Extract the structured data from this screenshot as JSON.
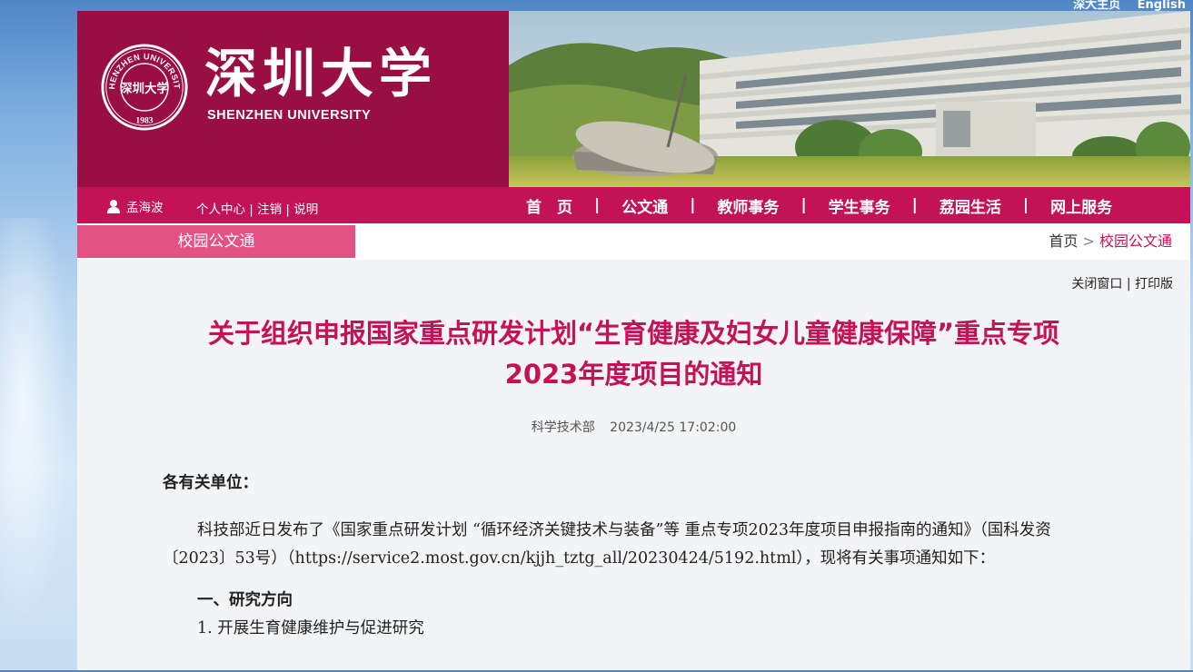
{
  "top_links": {
    "home": "深大主页",
    "english": "English"
  },
  "brand": {
    "cn_name": "深圳大学",
    "en_name": "SHENZHEN UNIVERSITY",
    "seal_text_top": "SHENZHEN UNIVERSITY",
    "seal_year": "1983",
    "seal_center": "深圳大学"
  },
  "user": {
    "name": "孟海波",
    "links": [
      "个人中心",
      "注销",
      "说明"
    ]
  },
  "nav": {
    "items": [
      "首　页",
      "公文通",
      "教师事务",
      "学生事务",
      "荔园生活",
      "网上服务"
    ]
  },
  "subnav": {
    "section": "校园公文通",
    "breadcrumb_home": "首页",
    "breadcrumb_sep": ">",
    "breadcrumb_current": "校园公文通"
  },
  "tools": {
    "close": "关闭窗口",
    "sep": "|",
    "print": "打印版"
  },
  "article": {
    "title_line1": "关于组织申报国家重点研发计划“生育健康及妇女儿童健康保障”重点专项",
    "title_line2": "2023年度项目的通知",
    "department": "科学技术部",
    "datetime": "2023/4/25 17:02:00",
    "salutation": "各有关单位：",
    "paragraph1": "科技部近日发布了《国家重点研发计划 “循环经济关键技术与装备”等 重点专项2023年度项目申报指南的通知》（国科发资〔2023〕53号）（https://service2.most.gov.cn/kjjh_tztg_all/20230424/5192.html），现将有关事项通知如下：",
    "section1": "一、研究方向",
    "item1": "1.  开展生育健康维护与促进研究"
  },
  "colors": {
    "brand_dark": "#9a0f43",
    "nav_bg": "#c31255",
    "subtab_bg": "#e35283",
    "title": "#c31255"
  }
}
